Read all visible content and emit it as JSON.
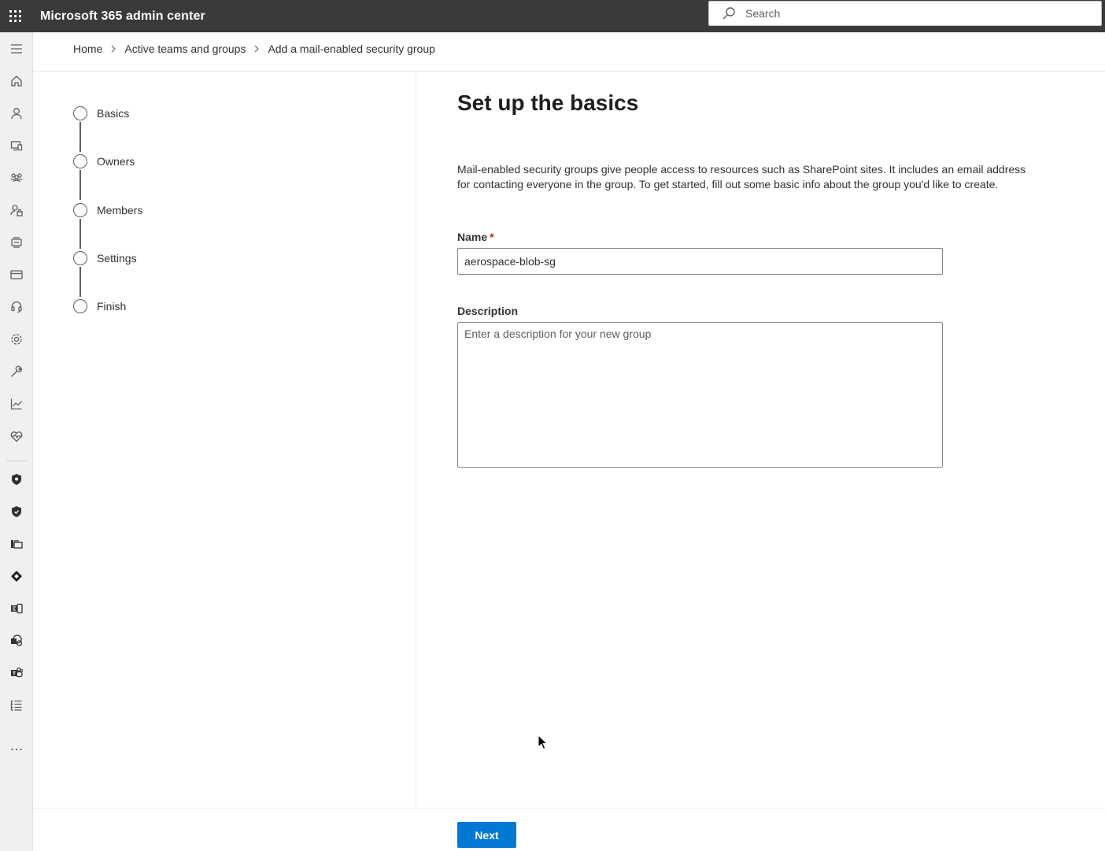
{
  "header": {
    "app_title": "Microsoft 365 admin center",
    "search_placeholder": "Search"
  },
  "nav_rail": {
    "items": [
      {
        "icon": "menu-icon"
      },
      {
        "icon": "home-icon"
      },
      {
        "icon": "user-icon"
      },
      {
        "icon": "devices-icon"
      },
      {
        "icon": "teams-groups-icon"
      },
      {
        "icon": "roles-icon"
      },
      {
        "icon": "resources-icon"
      },
      {
        "icon": "billing-icon"
      },
      {
        "icon": "support-icon"
      },
      {
        "icon": "settings-icon"
      },
      {
        "icon": "setup-icon"
      },
      {
        "icon": "reports-icon"
      },
      {
        "icon": "health-icon"
      },
      {
        "icon": "security-icon"
      },
      {
        "icon": "compliance-icon"
      },
      {
        "icon": "endpoint-manager-icon"
      },
      {
        "icon": "azure-ad-icon"
      },
      {
        "icon": "exchange-icon"
      },
      {
        "icon": "sharepoint-icon"
      },
      {
        "icon": "teams-icon"
      },
      {
        "icon": "all-admin-centers-icon"
      },
      {
        "icon": "more-icon"
      }
    ]
  },
  "breadcrumb": {
    "items": [
      "Home",
      "Active teams and groups",
      "Add a mail-enabled security group"
    ]
  },
  "steps": {
    "items": [
      {
        "label": "Basics"
      },
      {
        "label": "Owners"
      },
      {
        "label": "Members"
      },
      {
        "label": "Settings"
      },
      {
        "label": "Finish"
      }
    ]
  },
  "form": {
    "title": "Set up the basics",
    "description_line1": "Mail-enabled security groups give people access to resources such as SharePoint sites. It includes an email address",
    "description_line2": "for contacting everyone in the group. To get started, fill out some basic info about the group you'd like to create.",
    "name_label": "Name",
    "name_required_mark": "*",
    "name_value": "aerospace-blob-sg",
    "description_label": "Description",
    "description_placeholder": "Enter a description for your new group"
  },
  "footer": {
    "next_label": "Next"
  },
  "colors": {
    "topbar": "#3b3a39",
    "primary": "#0078d4",
    "required": "#a4262c"
  }
}
